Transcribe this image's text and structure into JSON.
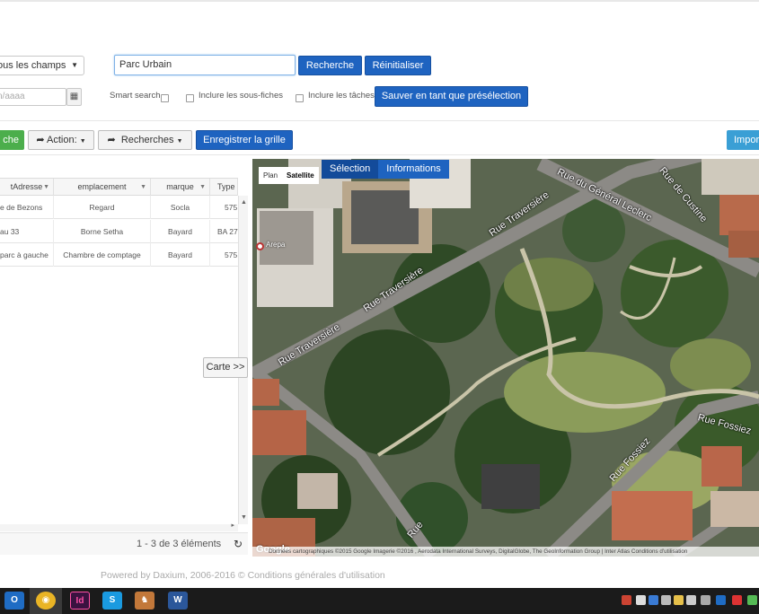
{
  "search": {
    "field_select": "ous les champs",
    "query": "Parc Urbain",
    "search_button": "Recherche",
    "reset_button": "Réinitialiser",
    "date_placeholder": "n/aaaa",
    "smart_search": "Smart search",
    "include_subsheets": "Inclure les sous-fiches",
    "include_tasks": "Inclure les tâches",
    "save_preset_button": "Sauver en tant que présélection"
  },
  "toolbar": {
    "green_button": "che",
    "action_button": "Action:",
    "searches_button": "Recherches",
    "save_grid_button": "Enregistrer la grille",
    "import_button": "Impor"
  },
  "grid": {
    "columns": [
      "tAdresse",
      "emplacement",
      "marque",
      "Type"
    ],
    "rows": [
      [
        "e de Bezons",
        "Regard",
        "Socla",
        "575"
      ],
      [
        "au 33",
        "Borne Setha",
        "Bayard",
        "BA 27"
      ],
      [
        "parc à gauche",
        "Chambre de comptage",
        "Bayard",
        "575"
      ]
    ],
    "pager_text": "1 - 3 de 3 éléments",
    "map_toggle": "Carte >>"
  },
  "map": {
    "type_plan": "Plan",
    "type_satellite": "Satellite",
    "tab_selection": "Sélection",
    "tab_informations": "Informations",
    "marker_label": "Arepa",
    "streets": [
      "Rue du Général Leclerc",
      "Rue de Custine",
      "Rue Traversière",
      "Rue Traversière",
      "Rue Traversière",
      "Rue Fossiez",
      "Rue Fossiez",
      "Rue"
    ],
    "google": "Google",
    "attribution": "Données cartographiques ©2015 Google Imagerie ©2016 , Aerodata International Surveys, DigitalGlobe, The GeoInformation Group | Inter Atlas    Conditions d'utilisation"
  },
  "footer": {
    "text": "Powered by Daxium, 2006-2016 ©   Conditions générales d'utilisation"
  },
  "taskbar": {
    "apps": [
      "outlook",
      "chrome",
      "indesign",
      "skype",
      "app",
      "word"
    ]
  },
  "colors": {
    "primary": "#1e63c0",
    "success": "#4cae4c",
    "info": "#3a9fd5"
  }
}
